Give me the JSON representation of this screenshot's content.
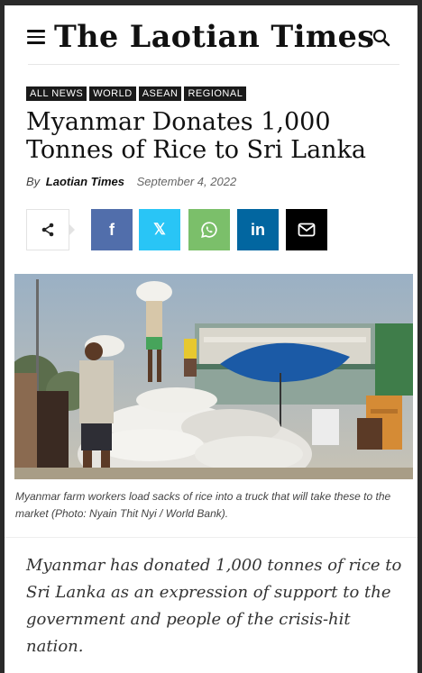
{
  "header": {
    "logo_text": "The Laotian Times"
  },
  "tags": [
    "ALL NEWS",
    "WORLD",
    "ASEAN",
    "REGIONAL"
  ],
  "article": {
    "headline": "Myanmar Donates 1,000 Tonnes of Rice to Sri Lanka",
    "by_label": "By",
    "author": "Laotian Times",
    "date": "September 4, 2022",
    "caption": "Myanmar farm workers load sacks of rice into a truck that will take these to the market (Photo: Nyain Thit Nyi / World Bank).",
    "lead": "Myanmar has donated 1,000 tonnes of rice to Sri Lanka as an expression of support to the government and people of the crisis-hit nation."
  },
  "share": {
    "facebook": "f",
    "x": "𝕏",
    "linkedin": "in"
  },
  "colors": {
    "facebook": "#516eab",
    "x": "#29c5f6",
    "whatsapp": "#7bbf6a",
    "linkedin": "#0266a0",
    "email": "#000000"
  }
}
